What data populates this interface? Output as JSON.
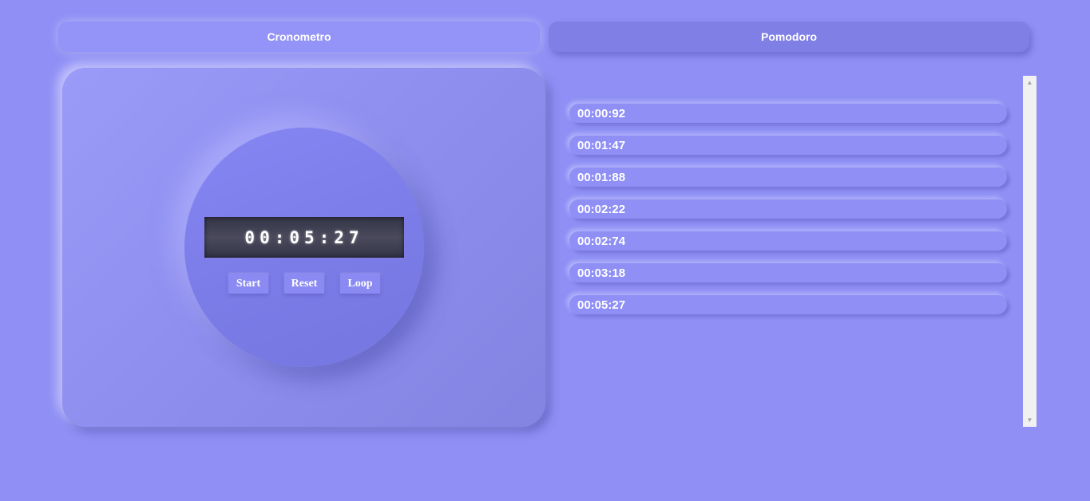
{
  "tabs": {
    "cronometro": "Cronometro",
    "pomodoro": "Pomodoro"
  },
  "stopwatch": {
    "display": "00:05:27",
    "buttons": {
      "start": "Start",
      "reset": "Reset",
      "loop": "Loop"
    }
  },
  "laps": [
    "00:00:92",
    "00:01:47",
    "00:01:88",
    "00:02:22",
    "00:02:74",
    "00:03:18",
    "00:05:27"
  ],
  "scrollbar": {
    "up_icon": "▲",
    "down_icon": "▼"
  },
  "colors": {
    "background": "#8f8ff5",
    "accent": "#7f7fe6",
    "display_bg": "#3c3c4e",
    "text": "#ffffff"
  }
}
